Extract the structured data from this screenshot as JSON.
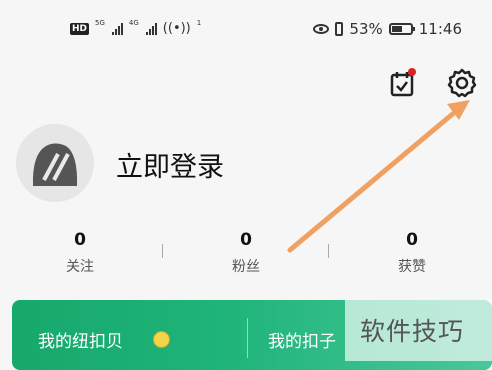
{
  "status_bar": {
    "network_badge": "HD",
    "signal_label_1": "5G",
    "signal_label_2": "4G",
    "wifi_label": "1",
    "battery": "53%",
    "time": "11:46",
    "battery_level": 0.53
  },
  "profile": {
    "login_text": "立即登录"
  },
  "stats": [
    {
      "value": "0",
      "label": "关注"
    },
    {
      "value": "0",
      "label": "粉丝"
    },
    {
      "value": "0",
      "label": "获赞"
    }
  ],
  "card": {
    "left_label": "我的纽扣贝",
    "right_label": "我的扣子"
  },
  "watermark": "软件技巧",
  "colors": {
    "accent_green": "#17a86b",
    "notification_red": "#e02020",
    "annotation_orange": "#f0a060"
  },
  "icons": {
    "calendar": "calendar-check-icon",
    "settings": "gear-icon",
    "coin": "coin-icon"
  }
}
